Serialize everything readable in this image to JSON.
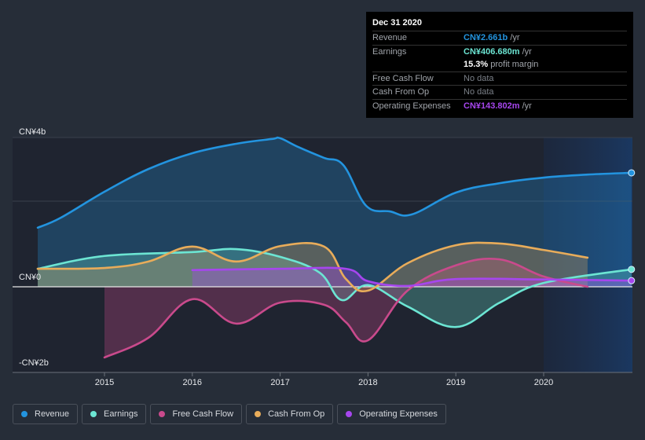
{
  "tooltip": {
    "date": "Dec 31 2020",
    "rows": [
      {
        "label": "Revenue",
        "value": "CN¥2.661b",
        "suffix": " /yr",
        "color": "#2394df"
      },
      {
        "label": "Earnings",
        "value": "CN¥406.680m",
        "suffix": " /yr",
        "color": "#6ce5d3"
      },
      {
        "label": "",
        "value": "15.3%",
        "suffix": " profit margin",
        "color": "#ffffff"
      },
      {
        "label": "Free Cash Flow",
        "value": "No data",
        "suffix": "",
        "color": "#7b8088"
      },
      {
        "label": "Cash From Op",
        "value": "No data",
        "suffix": "",
        "color": "#7b8088"
      },
      {
        "label": "Operating Expenses",
        "value": "CN¥143.802m",
        "suffix": " /yr",
        "color": "#a646ee"
      }
    ]
  },
  "legend": [
    {
      "label": "Revenue",
      "color": "#2394df"
    },
    {
      "label": "Earnings",
      "color": "#6ce5d3"
    },
    {
      "label": "Free Cash Flow",
      "color": "#c94a8c"
    },
    {
      "label": "Cash From Op",
      "color": "#e8ac5a"
    },
    {
      "label": "Operating Expenses",
      "color": "#a646ee"
    }
  ],
  "chart_data": {
    "type": "line",
    "title": "",
    "xlabel": "",
    "ylabel": "",
    "unit": "CN¥ billions",
    "y_tick_labels": [
      {
        "label": "CN¥4b",
        "value": 4
      },
      {
        "label": "CN¥0",
        "value": 0
      },
      {
        "label": "-CN¥2b",
        "value": -2
      }
    ],
    "x_tick_labels": [
      "2015",
      "2016",
      "2017",
      "2018",
      "2019",
      "2020"
    ],
    "x_ticks": [
      2015,
      2016,
      2017,
      2018,
      2019,
      2020
    ],
    "xlim": [
      2014.24,
      2021.0
    ],
    "ylim": [
      -2.0,
      3.45
    ],
    "forecast_region_start": 2020.0,
    "grid": true,
    "legend_position": "bottom",
    "series": [
      {
        "name": "Revenue",
        "color": "#2394df",
        "end_marker": true,
        "points": [
          [
            2014.24,
            1.38
          ],
          [
            2014.5,
            1.61
          ],
          [
            2015.0,
            2.22
          ],
          [
            2015.5,
            2.75
          ],
          [
            2016.0,
            3.12
          ],
          [
            2016.5,
            3.34
          ],
          [
            2016.9,
            3.45
          ],
          [
            2017.0,
            3.47
          ],
          [
            2017.2,
            3.27
          ],
          [
            2017.5,
            3.01
          ],
          [
            2017.72,
            2.84
          ],
          [
            2017.98,
            1.89
          ],
          [
            2018.25,
            1.76
          ],
          [
            2018.5,
            1.69
          ],
          [
            2019.0,
            2.2
          ],
          [
            2019.5,
            2.42
          ],
          [
            2020.0,
            2.55
          ],
          [
            2020.5,
            2.62
          ],
          [
            2021.0,
            2.661
          ]
        ]
      },
      {
        "name": "Earnings",
        "color": "#6ce5d3",
        "end_marker": true,
        "points": [
          [
            2014.24,
            0.42
          ],
          [
            2015.0,
            0.72
          ],
          [
            2016.0,
            0.81
          ],
          [
            2016.5,
            0.88
          ],
          [
            2017.0,
            0.7
          ],
          [
            2017.45,
            0.33
          ],
          [
            2017.7,
            -0.31
          ],
          [
            2018.0,
            0.04
          ],
          [
            2018.45,
            -0.46
          ],
          [
            2019.0,
            -0.94
          ],
          [
            2019.5,
            -0.37
          ],
          [
            2020.0,
            0.09
          ],
          [
            2021.0,
            0.4067
          ]
        ]
      },
      {
        "name": "Free Cash Flow",
        "color": "#c94a8c",
        "end_marker": false,
        "points": [
          [
            2015.0,
            -1.65
          ],
          [
            2015.5,
            -1.19
          ],
          [
            2016.0,
            -0.29
          ],
          [
            2016.5,
            -0.86
          ],
          [
            2017.0,
            -0.37
          ],
          [
            2017.5,
            -0.42
          ],
          [
            2017.75,
            -0.83
          ],
          [
            2018.0,
            -1.25
          ],
          [
            2018.45,
            -0.09
          ],
          [
            2019.0,
            0.5
          ],
          [
            2019.5,
            0.64
          ],
          [
            2020.0,
            0.24
          ],
          [
            2020.5,
            0.0
          ]
        ]
      },
      {
        "name": "Cash From Op",
        "color": "#e8ac5a",
        "end_marker": false,
        "points": [
          [
            2014.24,
            0.42
          ],
          [
            2015.0,
            0.44
          ],
          [
            2015.5,
            0.59
          ],
          [
            2016.0,
            0.94
          ],
          [
            2016.5,
            0.59
          ],
          [
            2017.0,
            0.95
          ],
          [
            2017.5,
            0.94
          ],
          [
            2017.75,
            0.18
          ],
          [
            2018.0,
            -0.09
          ],
          [
            2018.45,
            0.55
          ],
          [
            2019.0,
            0.97
          ],
          [
            2019.5,
            1.01
          ],
          [
            2020.0,
            0.86
          ],
          [
            2020.5,
            0.68
          ]
        ]
      },
      {
        "name": "Operating Expenses",
        "color": "#a646ee",
        "end_marker": true,
        "points": [
          [
            2016.0,
            0.39
          ],
          [
            2017.0,
            0.42
          ],
          [
            2017.75,
            0.42
          ],
          [
            2018.0,
            0.13
          ],
          [
            2018.45,
            0.02
          ],
          [
            2019.0,
            0.18
          ],
          [
            2020.0,
            0.17
          ],
          [
            2021.0,
            0.1438
          ]
        ]
      }
    ]
  }
}
